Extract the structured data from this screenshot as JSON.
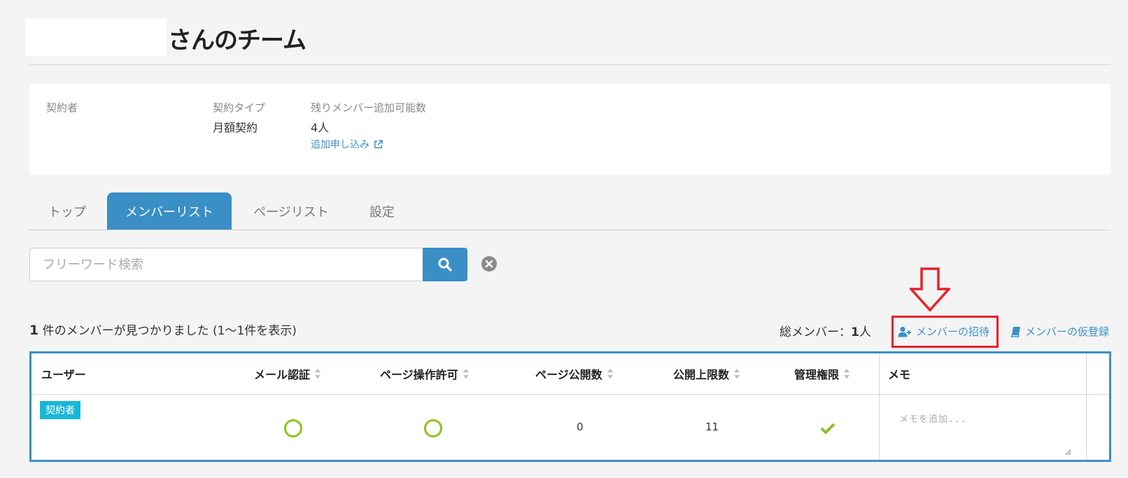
{
  "header": {
    "title": "さんのチーム"
  },
  "contract": {
    "holder_label": "契約者",
    "type_label": "契約タイプ",
    "type_value": "月額契約",
    "remaining_label": "残りメンバー追加可能数",
    "remaining_value": "4人",
    "add_request_link": "追加申し込み"
  },
  "tabs": [
    {
      "label": "トップ",
      "active": false
    },
    {
      "label": "メンバーリスト",
      "active": true
    },
    {
      "label": "ページリスト",
      "active": false
    },
    {
      "label": "設定",
      "active": false
    }
  ],
  "search": {
    "placeholder": "フリーワード検索",
    "value": ""
  },
  "results": {
    "count": "1",
    "summary": "件のメンバーが見つかりました (1〜1件を表示)",
    "total_label": "総メンバー：",
    "total_count": "1",
    "total_unit": "人"
  },
  "actions": {
    "invite": "メンバーの招待",
    "provisional_register": "メンバーの仮登録"
  },
  "table": {
    "headers": {
      "user": "ユーザー",
      "email_verified": "メール認証",
      "page_permission": "ページ操作許可",
      "published_pages": "ページ公開数",
      "publish_limit": "公開上限数",
      "admin": "管理権限",
      "memo": "メモ"
    },
    "rows": [
      {
        "badge": "契約者",
        "email_verified": true,
        "page_permission": true,
        "published_pages": "0",
        "publish_limit": "11",
        "admin": true,
        "memo_placeholder": "メモを追加..."
      }
    ]
  },
  "colors": {
    "accent": "#3a8fc6",
    "link": "#3a91c7",
    "highlight": "#e8202a",
    "ok_green": "#8dc21f",
    "badge": "#19b7d6"
  }
}
